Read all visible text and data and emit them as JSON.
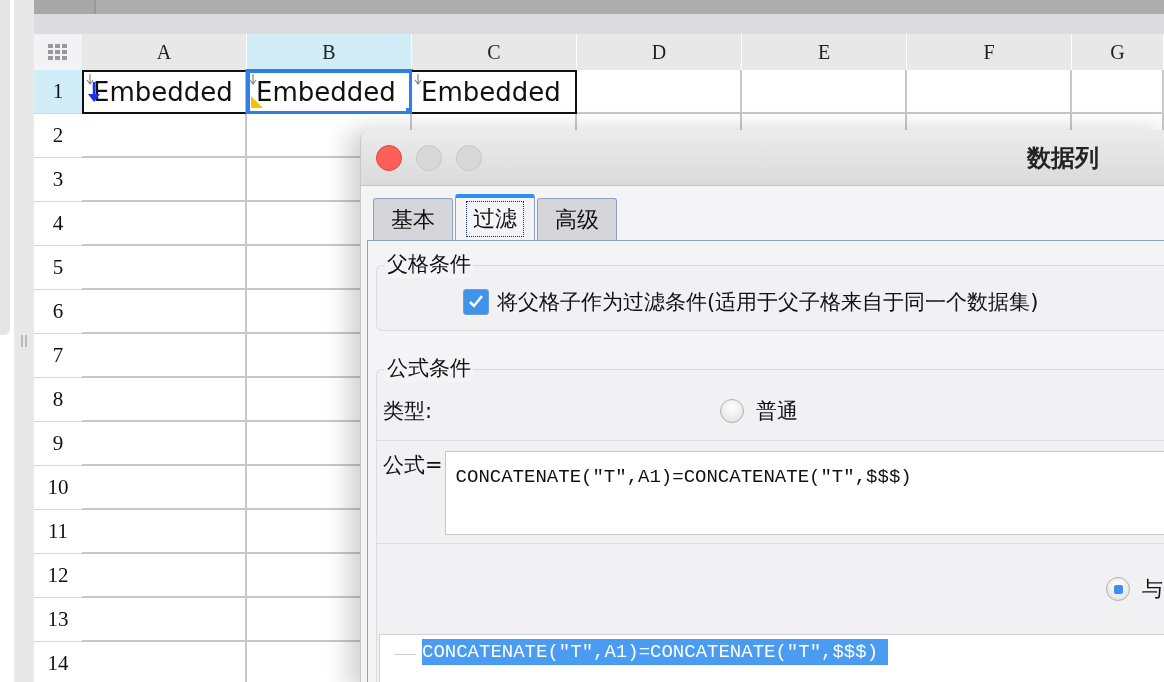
{
  "sheet": {
    "columns": [
      {
        "label": "A",
        "selected": false
      },
      {
        "label": "B",
        "selected": true
      },
      {
        "label": "C",
        "selected": false
      },
      {
        "label": "D",
        "selected": false
      },
      {
        "label": "E",
        "selected": false
      },
      {
        "label": "F",
        "selected": false
      },
      {
        "label": "G",
        "selected": false
      }
    ],
    "rows": [
      {
        "label": "1",
        "selected": true,
        "cells": [
          {
            "text": "Embedded",
            "selected": false,
            "kind": "expanded"
          },
          {
            "text": "Embedded",
            "selected": true,
            "kind": "flagged"
          },
          {
            "text": "Embedded",
            "selected": false,
            "kind": "plain"
          }
        ]
      },
      {
        "label": "2",
        "selected": false
      },
      {
        "label": "3",
        "selected": false
      },
      {
        "label": "4",
        "selected": false
      },
      {
        "label": "5",
        "selected": false
      },
      {
        "label": "6",
        "selected": false
      },
      {
        "label": "7",
        "selected": false
      },
      {
        "label": "8",
        "selected": false
      },
      {
        "label": "9",
        "selected": false
      },
      {
        "label": "10",
        "selected": false
      },
      {
        "label": "11",
        "selected": false
      },
      {
        "label": "12",
        "selected": false
      },
      {
        "label": "13",
        "selected": false
      },
      {
        "label": "14",
        "selected": false
      }
    ]
  },
  "dialog": {
    "title": "数据列",
    "tabs": [
      {
        "label": "基本",
        "selected": false
      },
      {
        "label": "过滤",
        "selected": true
      },
      {
        "label": "高级",
        "selected": false
      }
    ],
    "parent_condition": {
      "legend": "父格条件",
      "checkbox": {
        "label": "将父格子作为过滤条件(适用于父子格来自于同一个数据集)",
        "checked": true
      }
    },
    "formula_condition": {
      "legend": "公式条件",
      "type_label": "类型:",
      "type_options": [
        {
          "label": "普通",
          "selected": false
        }
      ],
      "formula_label": "公式=",
      "formula": "CONCATENATE(\"T\",A1)=CONCATENATE(\"T\",$$$)",
      "join_options": [
        {
          "label": "与",
          "selected": true
        }
      ],
      "conditions": [
        {
          "text": "CONCATENATE(\"T\",A1)=CONCATENATE(\"T\",$$$)",
          "selected": true
        }
      ]
    }
  }
}
